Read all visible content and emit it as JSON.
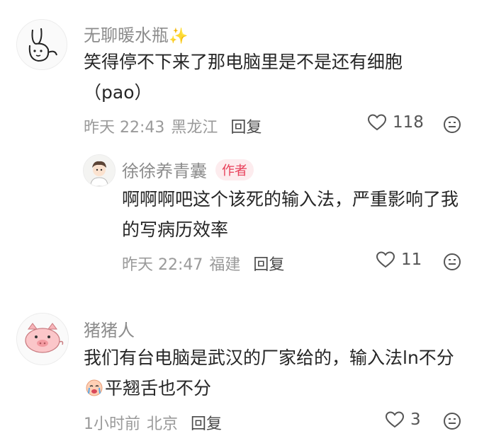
{
  "comments": [
    {
      "username": "无聊暖水瓶",
      "username_suffix": "✨",
      "text": "笑得停不下来了那电脑里是不是还有细胞（pao）",
      "time": "昨天 22:43",
      "location": "黑龙江",
      "reply_label": "回复",
      "likes": "118",
      "avatar_icon": "bunny-doodle-avatar"
    },
    {
      "username": "徐徐养青囊",
      "badge": "作者",
      "text": "啊啊啊吧这个该死的输入法，严重影响了我的写病历效率",
      "time": "昨天 22:47",
      "location": "福建",
      "reply_label": "回复",
      "likes": "11",
      "avatar_icon": "doctor-cartoon-avatar"
    },
    {
      "username": "猪猪人",
      "text_part1": "我们有台电脑是武汉的厂家给的，输入法ln不分",
      "text_part2": "平翘舌也不分",
      "inline_emoji": "crying-face-emoji",
      "time": "1小时前",
      "location": "北京",
      "reply_label": "回复",
      "likes": "3",
      "avatar_icon": "pig-avatar"
    }
  ],
  "icons": {
    "like": "heart-icon",
    "react": "emoji-reaction-icon"
  },
  "colors": {
    "badge_bg": "#fdecee",
    "badge_text": "#e8405a",
    "username": "#8c8c8c",
    "body": "#262626",
    "meta": "#9a9a9a"
  }
}
